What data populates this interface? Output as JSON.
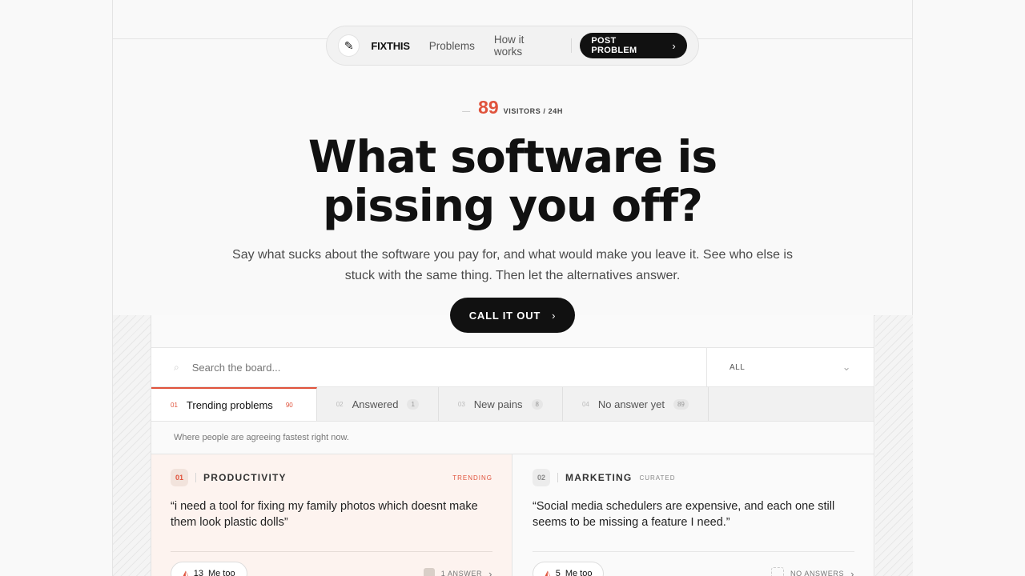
{
  "nav": {
    "brand": "FIXTHIS",
    "links": [
      "Problems",
      "How it works"
    ],
    "post_button": "POST PROBLEM"
  },
  "hero": {
    "visitor_count": "89",
    "visitor_label": "VISITORS / 24H",
    "headline_line1": "What software is",
    "headline_line2": "pissing you off?",
    "subtext": "Say what sucks about the software you pay for, and what would make you leave it. See who else is stuck with the same thing. Then let the alternatives answer.",
    "cta": "CALL IT OUT"
  },
  "board": {
    "search_placeholder": "Search the board...",
    "filter_value": "ALL",
    "tabs": [
      {
        "num": "01",
        "label": "Trending problems",
        "count": "90"
      },
      {
        "num": "02",
        "label": "Answered",
        "count": "1"
      },
      {
        "num": "03",
        "label": "New pains",
        "count": "8"
      },
      {
        "num": "04",
        "label": "No answer yet",
        "count": "89"
      }
    ],
    "tab_description": "Where people are agreeing fastest right now.",
    "cards": [
      {
        "rank": "01",
        "category": "PRODUCTIVITY",
        "tag": "TRENDING",
        "quote": "“i need a tool for fixing my family photos which doesnt make them look plastic dolls”",
        "metoo_count": "13",
        "metoo_label": "Me too",
        "answers": "1 ANSWER"
      },
      {
        "rank": "02",
        "category": "MARKETING",
        "tag": "CURATED",
        "quote": "“Social media schedulers are expensive, and each one still seems to be missing a feature I need.”",
        "metoo_count": "5",
        "metoo_label": "Me too",
        "answers": "NO ANSWERS"
      }
    ]
  },
  "colors": {
    "accent": "#e0533c",
    "dark": "#111111",
    "card_highlight": "#fdf3ef"
  },
  "icons": [
    "logo-icon",
    "chevron-right-icon",
    "search-icon",
    "chevron-down-icon",
    "upvote-icon"
  ]
}
